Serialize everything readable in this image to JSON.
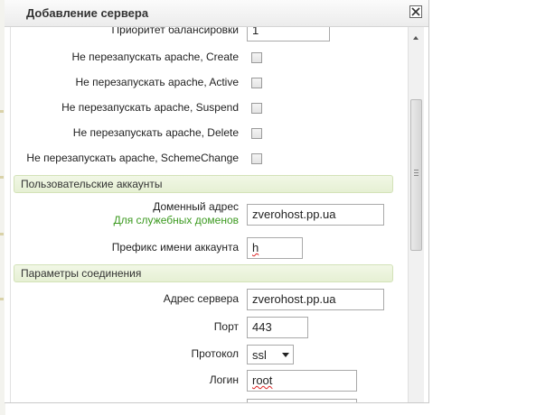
{
  "dialog": {
    "title": "Добавление сервера"
  },
  "fields": {
    "priority": {
      "label": "Приоритет балансировки",
      "value": "1"
    },
    "nr_create": {
      "label": "Не перезапускать apache, Create"
    },
    "nr_active": {
      "label": "Не перезапускать apache, Active"
    },
    "nr_suspend": {
      "label": "Не перезапускать apache, Suspend"
    },
    "nr_delete": {
      "label": "Не перезапускать apache, Delete"
    },
    "nr_scheme": {
      "label": "Не перезапускать apache, SchemeChange"
    },
    "domain": {
      "label": "Доменный адрес",
      "hint": "Для служебных доменов",
      "value": "zverohost.pp.ua"
    },
    "prefix": {
      "label": "Префикс имени аккаунта",
      "value": "h"
    },
    "server_addr": {
      "label": "Адрес сервера",
      "value": "zverohost.pp.ua"
    },
    "port": {
      "label": "Порт",
      "value": "443"
    },
    "protocol": {
      "label": "Протокол",
      "value": "ssl"
    },
    "login": {
      "label": "Логин",
      "value": "root"
    }
  },
  "sections": {
    "accounts": "Пользовательские аккаунты",
    "connection": "Параметры соединения"
  },
  "icons": {
    "close": "close-icon",
    "checkbox": "checkbox",
    "dropdown": "chevron-down-icon",
    "scroll": "scroll-up-icon"
  },
  "colors": {
    "hint_green": "#3c9a20",
    "section_bg": "#e6f0d4"
  }
}
